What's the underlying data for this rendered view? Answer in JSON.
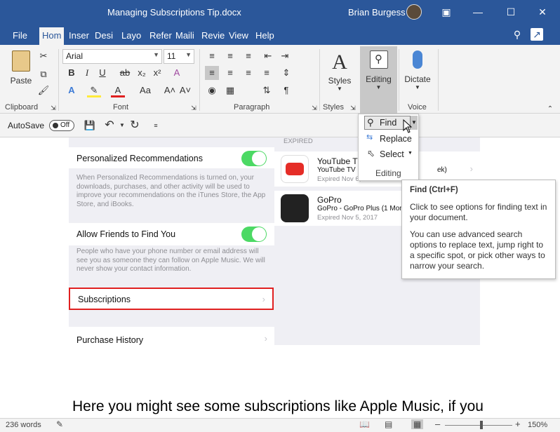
{
  "window": {
    "title": "Managing Subscriptions Tip.docx",
    "user": "Brian Burgess"
  },
  "tabs": [
    "File",
    "Hom",
    "Inser",
    "Desi",
    "Layo",
    "Refer",
    "Maili",
    "Revie",
    "View",
    "Help"
  ],
  "ribbon": {
    "paste_label": "Paste",
    "font_name": "Arial",
    "font_size": "11",
    "styles_label": "Styles",
    "editing_label": "Editing",
    "dictate_label": "Dictate",
    "groups": {
      "clipboard": "Clipboard",
      "font": "Font",
      "paragraph": "Paragraph",
      "styles": "Styles",
      "voice": "Voice"
    }
  },
  "qat": {
    "autosave_label": "AutoSave",
    "autosave_state": "Off"
  },
  "editing_menu": {
    "find": "Find",
    "replace": "Replace",
    "select": "Select",
    "group_label": "Editing"
  },
  "tooltip": {
    "title": "Find (Ctrl+F)",
    "line1": "Click to see options for finding text in your document.",
    "line2": "You can use advanced search options to replace text, jump right to a specific spot, or pick other ways to narrow your search."
  },
  "doc_image": {
    "expired_header": "EXPIRED",
    "personalized_title": "Personalized Recommendations",
    "personalized_desc": "When Personalized Recommendations is turned on, your downloads, purchases, and other activity will be used to improve your recommendations on the iTunes Store, the App Store, and iBooks.",
    "allow_friends_title": "Allow Friends to Find You",
    "allow_friends_desc": "People who have your phone number or email address will see you as someone they can follow on Apple Music. We will never show your contact information.",
    "subscriptions": "Subscriptions",
    "purchase_history": "Purchase History",
    "apps": [
      {
        "name": "YouTube TV",
        "sub": "YouTube TV",
        "sub_suffix": "ek)",
        "date": "Expired Nov 6, 2017"
      },
      {
        "name": "GoPro",
        "sub": "GoPro - GoPro Plus (1 Month)",
        "date": "Expired Nov 5, 2017"
      }
    ]
  },
  "doc_text": "Here you might see some subscriptions like Apple Music, if you",
  "status": {
    "words": "236 words",
    "zoom": "150%"
  },
  "colors": {
    "brand": "#2b579a",
    "toggle_on": "#4cd964",
    "highlight_box": "#e02020"
  }
}
